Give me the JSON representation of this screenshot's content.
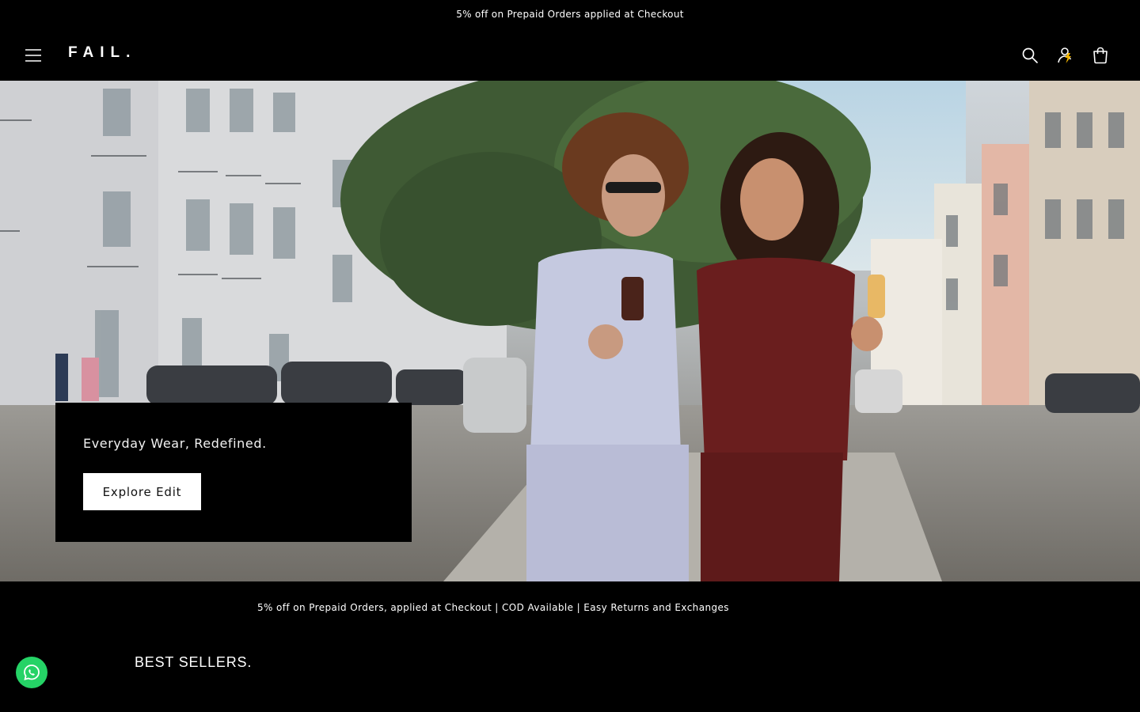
{
  "announcement": {
    "text": "5% off on Prepaid Orders applied at Checkout"
  },
  "header": {
    "logo_text": "FAIL.",
    "icons": {
      "menu": "menu-icon",
      "search": "search-icon",
      "account": "account-icon",
      "cart": "cart-icon"
    },
    "account_accent_color": "#f5b800"
  },
  "hero": {
    "heading": "Everyday Wear, Redefined.",
    "cta_label": "Explore Edit"
  },
  "marquee": {
    "text": "5% off on Prepaid Orders, applied at Checkout | COD Available | Easy Returns and Exchanges"
  },
  "best_sellers": {
    "title": "BEST SELLERS."
  },
  "whatsapp": {
    "icon": "whatsapp-icon",
    "color": "#25d366"
  }
}
